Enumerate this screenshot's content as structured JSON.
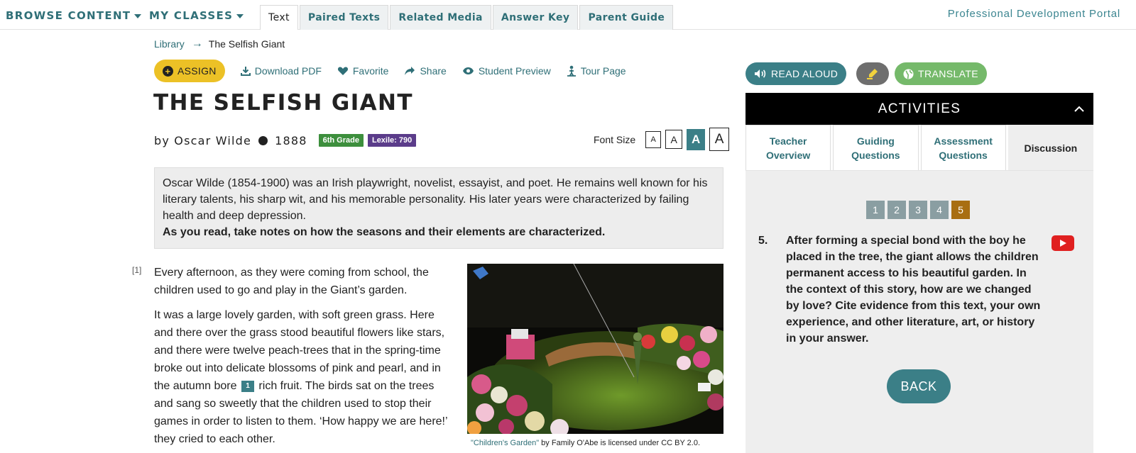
{
  "nav": {
    "browse_label": "BROWSE CONTENT",
    "classes_label": "MY CLASSES",
    "tabs": [
      "Text",
      "Paired Texts",
      "Related Media",
      "Answer Key",
      "Parent Guide"
    ],
    "pd_link": "Professional Development Portal"
  },
  "breadcrumb": {
    "library": "Library",
    "current": "The Selfish Giant"
  },
  "actions": {
    "assign": "ASSIGN",
    "download": "Download PDF",
    "favorite": "Favorite",
    "share": "Share",
    "preview": "Student Preview",
    "tour": "Tour Page"
  },
  "text": {
    "title": "THE SELFISH GIANT",
    "author": "by Oscar Wilde",
    "year": "1888",
    "grade": "6th Grade",
    "lexile": "Lexile: 790",
    "font_size_label": "Font Size",
    "font_sizes": [
      "A",
      "A",
      "A",
      "A"
    ],
    "intro": "Oscar Wilde (1854-1900) was an Irish playwright, novelist, essayist, and poet. He remains well known for his literary talents, his sharp wit, and his memorable personality. His later years were characterized by failing health and deep depression.",
    "intro_prompt": "As you read, take notes on how the seasons and their elements are characterized.",
    "paragraph_number": "[1]",
    "paragraph1": "Every afternoon, as they were coming from school, the children used to go and play in the Giant’s garden.",
    "paragraph2_a": "It was a large lovely garden, with soft green grass. Here and there over the grass stood beautiful flowers like stars, and there were twelve peach-trees that in the spring-time broke out into delicate blossoms of pink and pearl, and in the autumn bore",
    "footnote": "1",
    "paragraph2_b": " rich fruit. The birds sat on the trees and sang so sweetly that the children used to stop their games in order to listen to them. ‘How happy we are here!’ they cried to each other.",
    "caption_link": "\"Children's Garden\"",
    "caption_rest": " by Family O'Abe is licensed under CC BY 2.0."
  },
  "tools": {
    "read_aloud": "READ ALOUD",
    "translate": "TRANSLATE"
  },
  "activities": {
    "header": "ACTIVITIES",
    "tabs": [
      "Teacher Overview",
      "Guiding Questions",
      "Assessment Questions",
      "Discussion"
    ],
    "pages": [
      "1",
      "2",
      "3",
      "4",
      "5"
    ],
    "question_number": "5.",
    "question": "After forming a special bond with the boy he placed in the tree, the giant allows the children permanent access to his beautiful garden. In the context of this story, how are we changed by love? Cite evidence from this text, your own experience, and other literature, art, or history in your answer.",
    "back": "BACK"
  },
  "colors": {
    "teal": "#3b7f87",
    "assign_yellow": "#ecc126",
    "grade_green": "#3d8f3d",
    "lexile_purple": "#5b3c8a",
    "active_page": "#a86e12"
  }
}
